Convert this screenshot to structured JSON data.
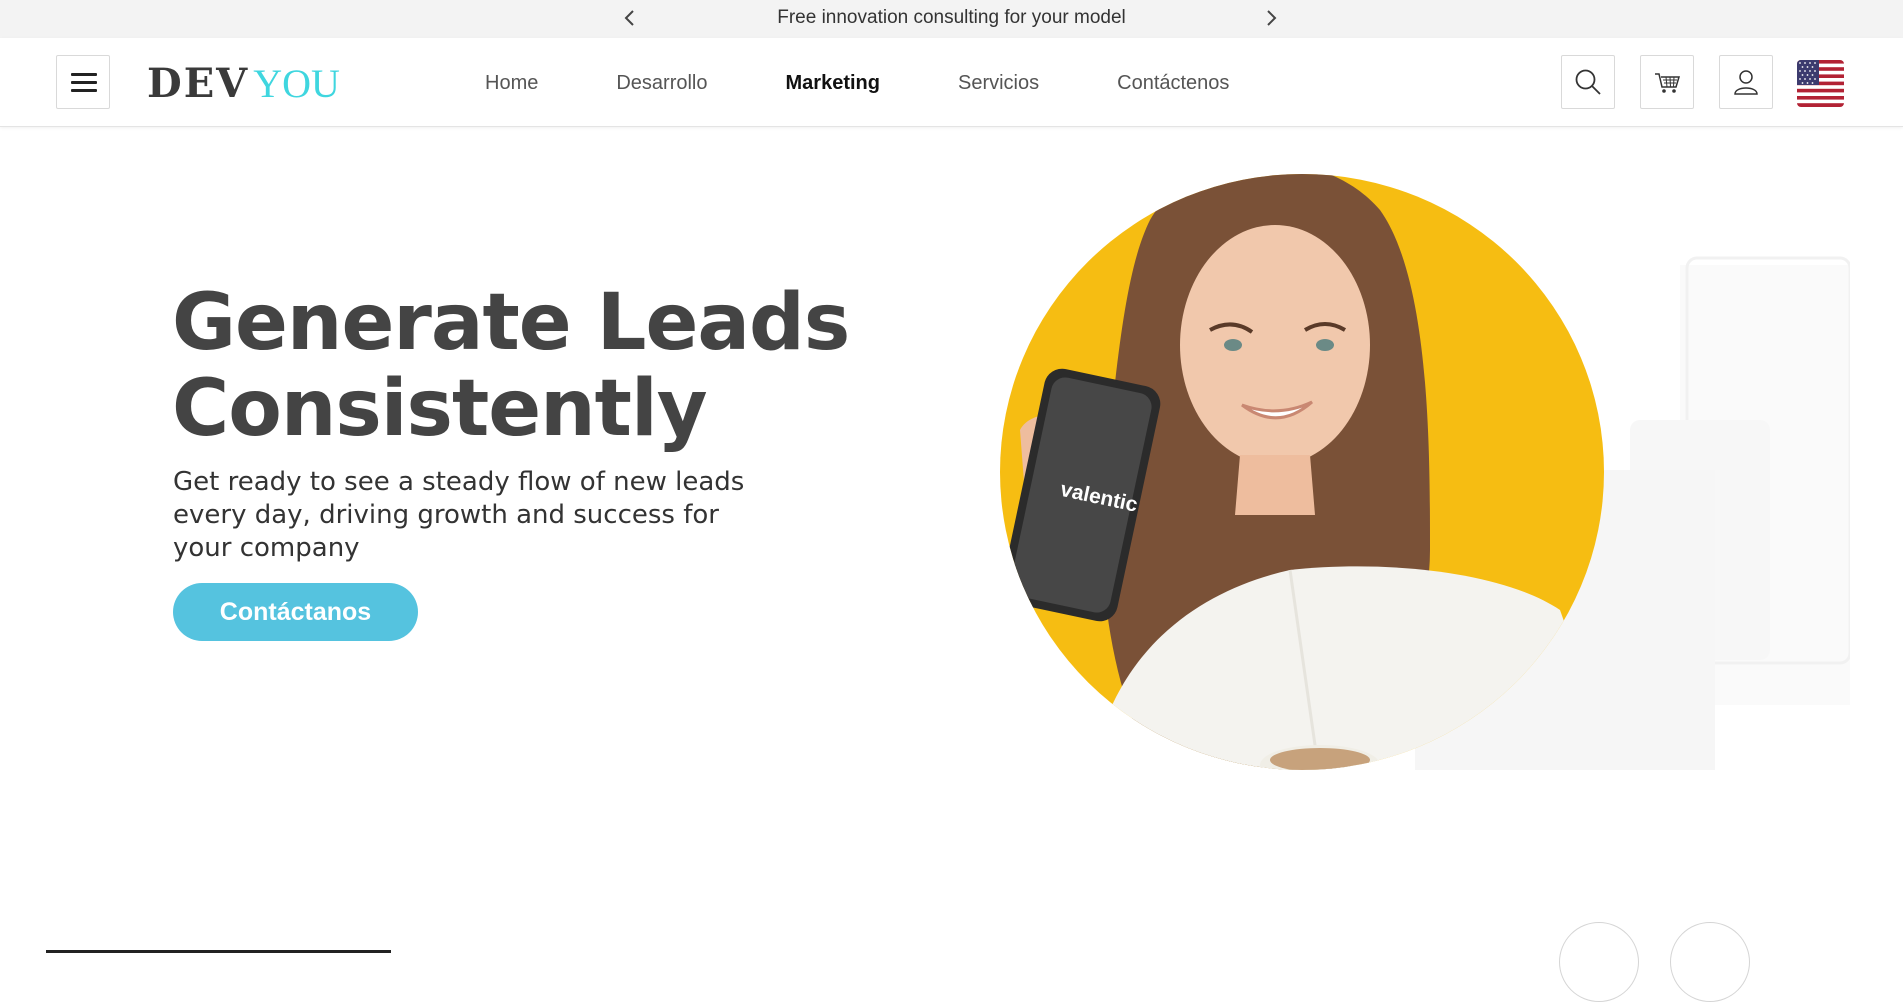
{
  "announcement": {
    "message": "Free innovation consulting for your model",
    "prev_icon": "chevron-left-icon",
    "next_icon": "chevron-right-icon"
  },
  "header": {
    "menu_icon": "hamburger-icon",
    "logo": {
      "part1": "DEV",
      "part2": "YOU",
      "accent": "#3fd6df"
    },
    "nav": [
      {
        "label": "Home",
        "active": false
      },
      {
        "label": "Desarrollo",
        "active": false
      },
      {
        "label": "Marketing",
        "active": true
      },
      {
        "label": "Servicios",
        "active": false
      },
      {
        "label": "Contácteno s"
      }
    ],
    "actions": [
      "search-icon",
      "cart-icon",
      "user-icon",
      "us-flag-icon"
    ]
  },
  "hero": {
    "title_line1": "Generate Leads",
    "title_line2": "Consistently",
    "subtitle": "Get ready to see a steady flow of new leads every day, driving growth and success for your company",
    "cta_label": "Contáctanos",
    "phone_brand": "valentic",
    "cta_color": "#55c3df",
    "circle_color": "#f6bd12"
  }
}
